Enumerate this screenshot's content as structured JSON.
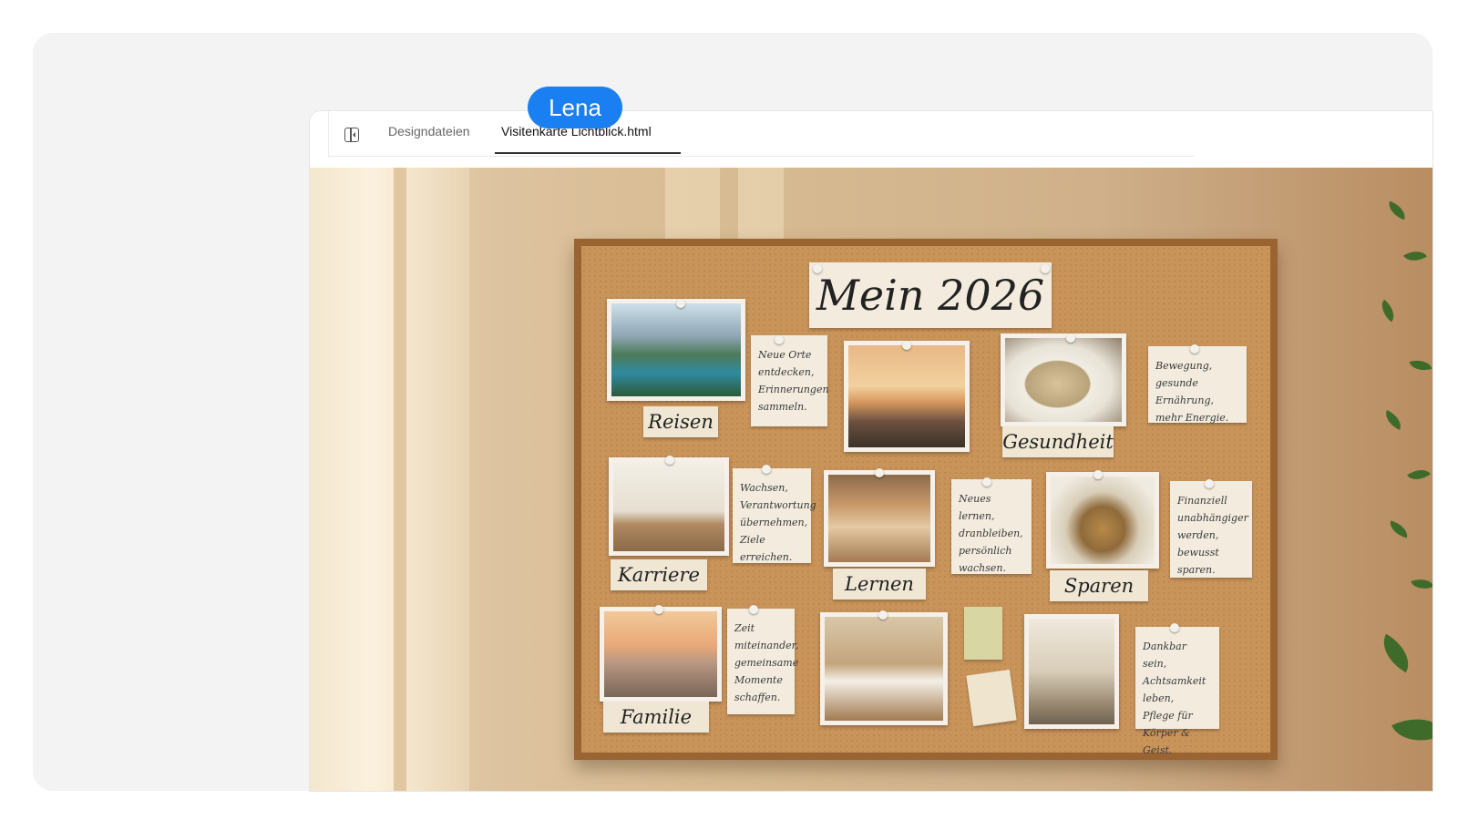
{
  "tabs": {
    "items": [
      {
        "label": "Designdateien"
      },
      {
        "label": "Visitenkarte Lichtblick.html"
      }
    ],
    "active_index": 1
  },
  "cursor": {
    "name": "Lena",
    "color": "#1a7ff0"
  },
  "board": {
    "title": "Mein 2026",
    "labels": [
      "Reisen",
      "Gesundheit",
      "Karriere",
      "Lernen",
      "Sparen",
      "Familie"
    ],
    "notes": [
      "Neue Orte\nentdecken,\nErinnerungen\nsammeln.",
      "Bewegung,\ngesunde Ernährung,\nmehr Energie.",
      "Wachsen,\nVerantwortung\nübernehmen,\nZiele erreichen.",
      "Neues lernen,\ndranbleiben,\npersönlich\nwachsen.",
      "Finanziell\nunabhängiger\nwerden,\nbewusst sparen.",
      "Zeit\nmiteinander,\ngemeinsame\nMomente\nschaffen.",
      "Dankbar sein,\nAchtsamkeit\nleben,\nPflege für\nKörper & Geist."
    ]
  },
  "colors": {
    "accent": "#1a7ff0",
    "cork": "#c9945a",
    "frame": "#9a6332"
  }
}
